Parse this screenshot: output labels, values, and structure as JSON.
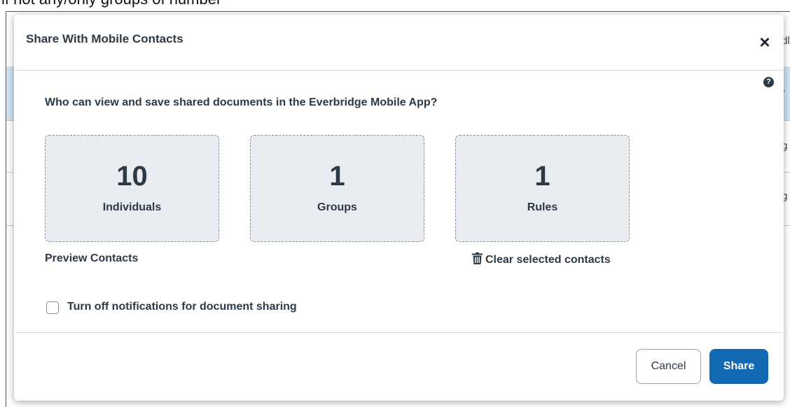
{
  "background": {
    "top_text": "lf not any/only groups of number",
    "edge_texts": [
      "dl",
      "r",
      "g",
      "g"
    ]
  },
  "modal": {
    "title": "Share With Mobile Contacts",
    "close_symbol": "×",
    "help_symbol": "?",
    "question": "Who can view and save shared documents in the Everbridge Mobile App?",
    "cards": [
      {
        "count": "10",
        "label": "Individuals"
      },
      {
        "count": "1",
        "label": "Groups"
      },
      {
        "count": "1",
        "label": "Rules"
      }
    ],
    "preview_link": "Preview Contacts",
    "clear_link": "Clear selected contacts",
    "checkbox_label": "Turn off notifications for document sharing",
    "checkbox_checked": false,
    "cancel_label": "Cancel",
    "share_label": "Share"
  },
  "colors": {
    "primary_button": "#1369b1",
    "text": "#2d3a45",
    "card_bg": "#e9edf1",
    "row_highlight": "#cfe3f3"
  },
  "icons": {
    "close": "close-icon",
    "help": "question-circle-icon",
    "clear": "trash-icon"
  }
}
